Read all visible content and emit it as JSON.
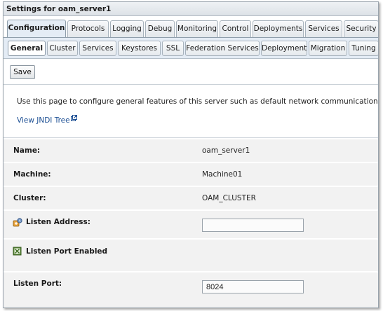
{
  "title": "Settings for oam_server1",
  "tabs": [
    "Configuration",
    "Protocols",
    "Logging",
    "Debug",
    "Monitoring",
    "Control",
    "Deployments",
    "Services",
    "Security"
  ],
  "subtabs": [
    "General",
    "Cluster",
    "Services",
    "Keystores",
    "SSL",
    "Federation Services",
    "Deployment",
    "Migration",
    "Tuning"
  ],
  "toolbar": {
    "save_label": "Save"
  },
  "description": "Use this page to configure general features of this server such as default network communications.",
  "jndi_link": "View JNDI Tree",
  "fields": {
    "name_label": "Name:",
    "name_value": "oam_server1",
    "machine_label": "Machine:",
    "machine_value": "Machine01",
    "cluster_label": "Cluster:",
    "cluster_value": "OAM_CLUSTER",
    "listen_address_label": "Listen Address:",
    "listen_address_value": "",
    "listen_port_enabled_label": "Listen Port Enabled",
    "listen_port_label": "Listen Port:",
    "listen_port_value": "8024"
  },
  "colors": {
    "active_tab_bg": "#e4ecf5",
    "link": "#1b4e93",
    "row_bg": "#f2f2f2"
  }
}
